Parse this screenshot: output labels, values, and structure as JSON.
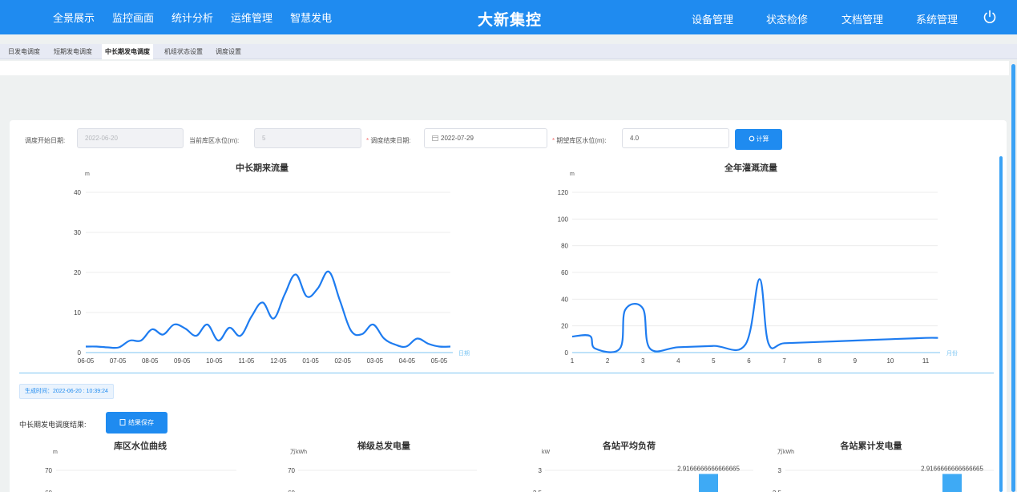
{
  "topnav": {
    "left_items": [
      "全景展示",
      "监控画面",
      "统计分析",
      "运维管理",
      "智慧发电"
    ],
    "brand": "大新集控",
    "right_items": [
      "设备管理",
      "状态检修",
      "文档管理",
      "系统管理"
    ],
    "power_icon": "power-icon"
  },
  "tabs": [
    "日发电调度",
    "短期发电调度",
    "中长期发电调度",
    "机组状态设置",
    "调度设置"
  ],
  "active_tab": "中长期发电调度",
  "form": {
    "start_date_label": "调度开始日期:",
    "start_date_value": "2022-06-20",
    "current_level_label": "当前库区水位(m):",
    "current_level_value": "5",
    "end_date_label": "调度结束日期:",
    "end_date_value": "2022-07-29",
    "expected_level_label": "期望库区水位(m):",
    "expected_level_value": "4.0",
    "calc_button": "计算",
    "required_mark": "*"
  },
  "colors": {
    "brand": "#1f8bf0",
    "line": "#1e7cf0"
  },
  "chart_data": [
    {
      "type": "line",
      "title": "中长期来流量",
      "ylabel": "m",
      "xlabel": "日期",
      "ylim": [
        0,
        40
      ],
      "yticks": [
        0,
        10,
        20,
        30,
        40
      ],
      "x_tick_labels": [
        "06-05",
        "07-05",
        "08-05",
        "09-05",
        "10-05",
        "11-05",
        "12-05",
        "01-05",
        "02-05",
        "03-05",
        "04-05",
        "05-05"
      ],
      "values": [
        1.5,
        1.5,
        1.3,
        1.3,
        3.0,
        3.0,
        5.8,
        4.5,
        7.0,
        6.0,
        4.2,
        7.0,
        3.0,
        6.2,
        4.2,
        9.0,
        12.5,
        8.5,
        14.5,
        19.5,
        14.0,
        16.0,
        20.2,
        13.0,
        5.5,
        4.6,
        7.0,
        3.5,
        2.0,
        1.5,
        3.5,
        2.2,
        1.5,
        1.5
      ]
    },
    {
      "type": "line",
      "title": "全年灌溉流量",
      "ylabel": "m",
      "xlabel": "月份",
      "ylim": [
        0,
        120
      ],
      "yticks": [
        0,
        20,
        40,
        60,
        80,
        100,
        120
      ],
      "x": [
        1,
        2,
        3,
        4,
        5,
        6,
        7,
        8,
        9,
        10,
        11
      ],
      "points": [
        [
          1,
          12
        ],
        [
          1.5,
          12.5
        ],
        [
          1.65,
          3
        ],
        [
          2.35,
          3
        ],
        [
          2.5,
          32
        ],
        [
          3.0,
          33
        ],
        [
          3.2,
          3
        ],
        [
          4,
          4
        ],
        [
          5,
          5
        ],
        [
          5.9,
          6
        ],
        [
          6.3,
          55
        ],
        [
          6.55,
          7
        ],
        [
          7,
          7
        ],
        [
          8,
          8
        ],
        [
          9,
          9
        ],
        [
          10,
          10
        ],
        [
          11,
          11
        ],
        [
          11.35,
          11
        ]
      ]
    },
    {
      "type": "line",
      "title": "库区水位曲线",
      "ylabel": "m",
      "yticks": [
        60,
        70
      ]
    },
    {
      "type": "bar",
      "title": "梯级总发电量",
      "ylabel": "万kWh",
      "yticks": [
        60,
        70
      ]
    },
    {
      "type": "bar",
      "title": "各站平均负荷",
      "ylabel": "kW",
      "yticks": [
        2.5,
        3
      ],
      "data_labels": [
        "2.9166666666666665"
      ],
      "values": [
        2.9166666666666665
      ]
    },
    {
      "type": "bar",
      "title": "各站累计发电量",
      "ylabel": "万kWh",
      "yticks": [
        2.5,
        3
      ],
      "data_labels": [
        "2.9166666666666665"
      ],
      "values": [
        2.9166666666666665
      ]
    }
  ],
  "result": {
    "generated_time": "生成时间：2022-06-20 : 10:39:24",
    "label": "中长期发电调度结果:",
    "save_button": "结果保存"
  }
}
